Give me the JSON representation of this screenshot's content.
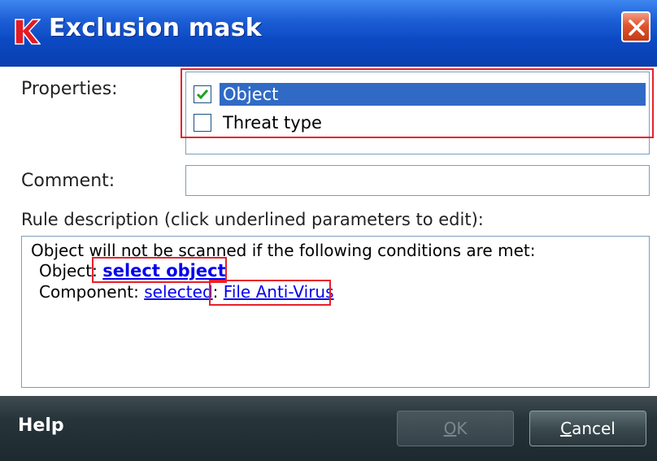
{
  "window": {
    "title": "Exclusion mask",
    "title_bar_color": "#0b49c3",
    "logo_icon": "kaspersky-k-icon",
    "close_icon": "close-icon"
  },
  "properties": {
    "label": "Properties:",
    "items": [
      {
        "label": "Object",
        "checked": true,
        "selected": true
      },
      {
        "label": "Threat type",
        "checked": false,
        "selected": false
      }
    ]
  },
  "comment": {
    "label": "Comment:",
    "value": "",
    "placeholder": ""
  },
  "rule_description": {
    "label": "Rule description (click underlined parameters to edit):",
    "line1": "Object will not be scanned if the following conditions are met:",
    "object_prefix": "Object: ",
    "object_link": "select object",
    "component_prefix": "Component: ",
    "component_link_selected": "selected",
    "component_separator": ": ",
    "component_link_value": "File Anti-Virus"
  },
  "footer": {
    "help_label": "Help",
    "ok_accel": "O",
    "ok_rest": "K",
    "ok_enabled": false,
    "cancel_accel": "C",
    "cancel_rest": "ancel"
  },
  "colors": {
    "highlight": "#e8202a",
    "selection": "#316ac5",
    "link": "#0000ee",
    "footer": "#27353a"
  }
}
